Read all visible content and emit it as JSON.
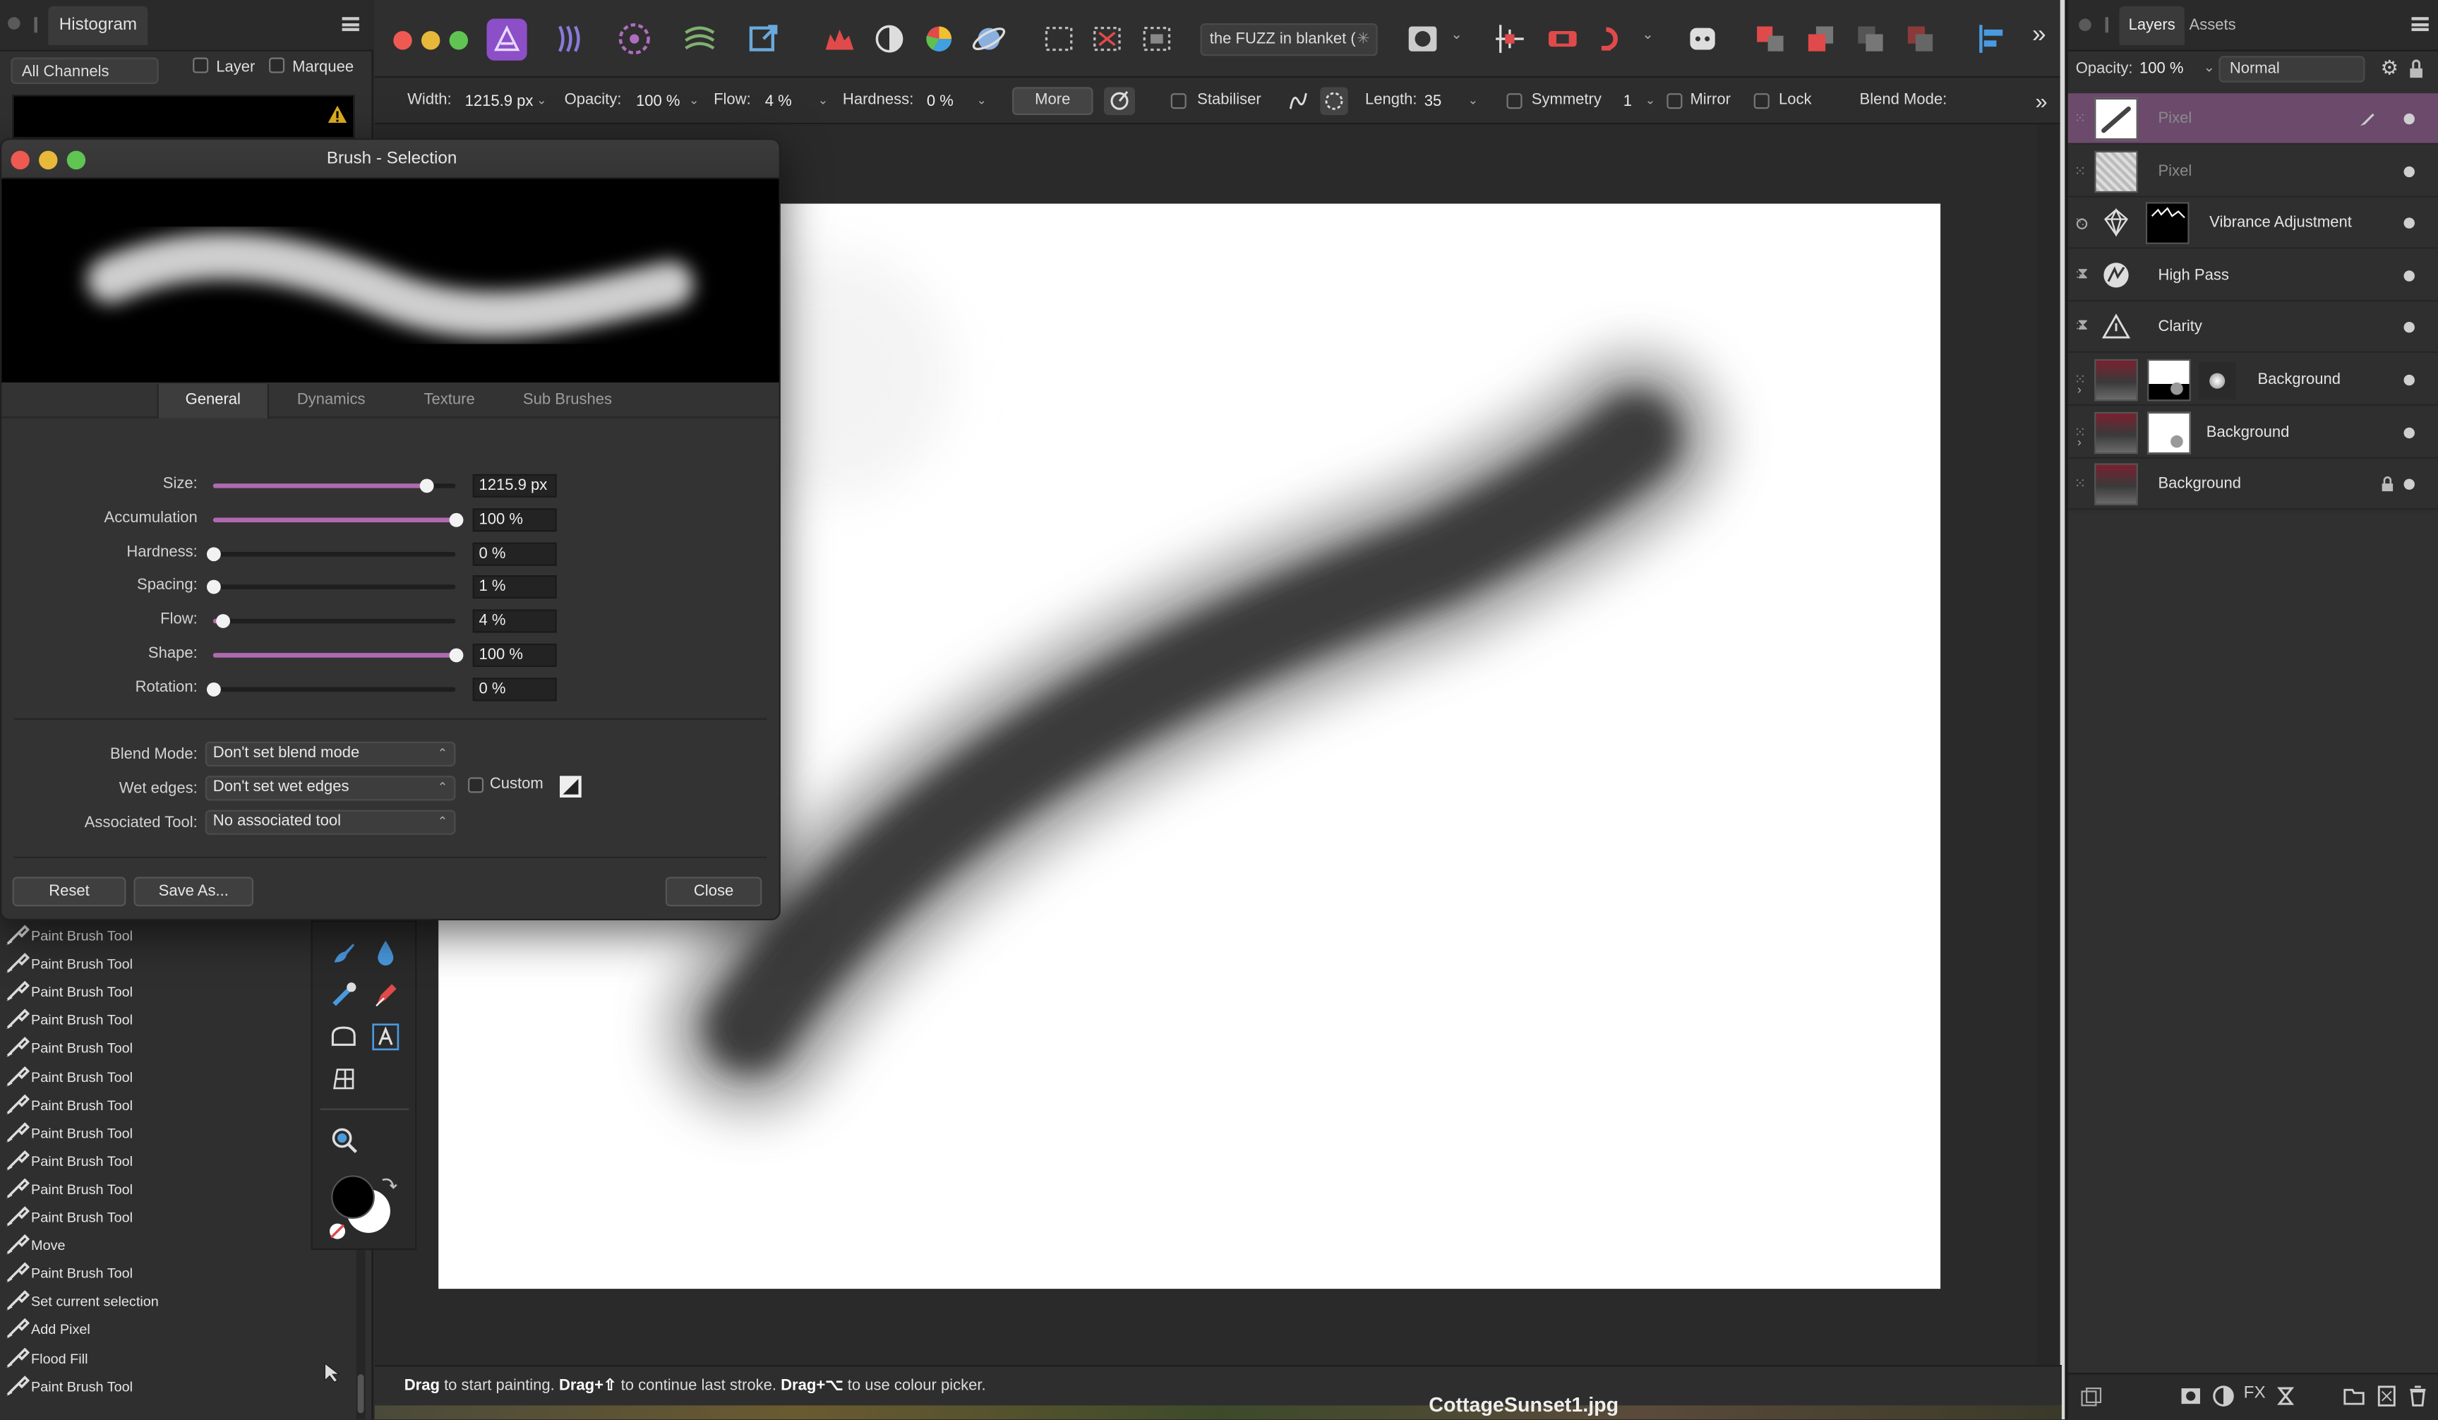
{
  "histogram": {
    "panel_title": "Histogram",
    "channels": "All Channels",
    "layer_label": "Layer",
    "marquee_label": "Marquee",
    "items": [
      "Paint Brush Tool",
      "Paint Brush Tool",
      "Paint Brush Tool",
      "Paint Brush Tool",
      "Paint Brush Tool",
      "Paint Brush Tool",
      "Paint Brush Tool",
      "Paint Brush Tool",
      "Paint Brush Tool",
      "Paint Brush Tool",
      "Paint Brush Tool",
      "Move",
      "Paint Brush Tool",
      "Set current selection",
      "Add Pixel",
      "Flood Fill",
      "Paint Brush Tool"
    ]
  },
  "toolbar": {
    "document_title": "the FUZZ in blanket (",
    "accent": "#8c4fc7"
  },
  "context": {
    "width_label": "Width:",
    "width_value": "1215.9 px",
    "opacity_label": "Opacity:",
    "opacity_value": "100 %",
    "flow_label": "Flow:",
    "flow_value": "4 %",
    "hardness_label": "Hardness:",
    "hardness_value": "0 %",
    "more_label": "More",
    "stabiliser_label": "Stabiliser",
    "length_label": "Length:",
    "length_value": "35",
    "symmetry_label": "Symmetry",
    "symmetry_value": "1",
    "mirror_label": "Mirror",
    "lock_label": "Lock",
    "blend_mode_label": "Blend Mode:"
  },
  "status": {
    "drag1": "Drag",
    "text1": " to start painting. ",
    "drag2": "Drag+⇧",
    "text2": " to continue last stroke. ",
    "drag3": "Drag+⌥",
    "text3": " to use colour picker."
  },
  "filename": "CottageSunset1.jpg",
  "layers": {
    "tab_layers": "Layers",
    "tab_assets": "Assets",
    "opacity_label": "Opacity:",
    "opacity_value": "100 %",
    "blend_mode": "Normal",
    "items": [
      {
        "name": "Pixel"
      },
      {
        "name": "Pixel"
      },
      {
        "name": "Vibrance Adjustment"
      },
      {
        "name": "High Pass"
      },
      {
        "name": "Clarity"
      },
      {
        "name": "Background"
      },
      {
        "name": "Background"
      },
      {
        "name": "Background"
      }
    ],
    "selected_color": "#6b4a6c"
  },
  "dialog": {
    "title": "Brush - Selection",
    "tabs": [
      "General",
      "Dynamics",
      "Texture",
      "Sub Brushes"
    ],
    "sliders": [
      {
        "label": "Size:",
        "value": "1215.9 px",
        "level": 0.88
      },
      {
        "label": "Accumulation",
        "value": "100 %",
        "level": 1.0
      },
      {
        "label": "Hardness:",
        "value": "0 %",
        "level": 0.0
      },
      {
        "label": "Spacing:",
        "value": "1 %",
        "level": 0.0
      },
      {
        "label": "Flow:",
        "value": "4 %",
        "level": 0.04
      },
      {
        "label": "Shape:",
        "value": "100 %",
        "level": 1.0
      },
      {
        "label": "Rotation:",
        "value": "0 %",
        "level": 0.0
      }
    ],
    "blend_mode_label": "Blend Mode:",
    "blend_mode_value": "Don't set blend mode",
    "wet_edges_label": "Wet edges:",
    "wet_edges_value": "Don't set wet edges",
    "custom_label": "Custom",
    "assoc_tool_label": "Associated Tool:",
    "assoc_tool_value": "No associated tool",
    "reset_label": "Reset",
    "save_as_label": "Save As...",
    "close_label": "Close"
  }
}
